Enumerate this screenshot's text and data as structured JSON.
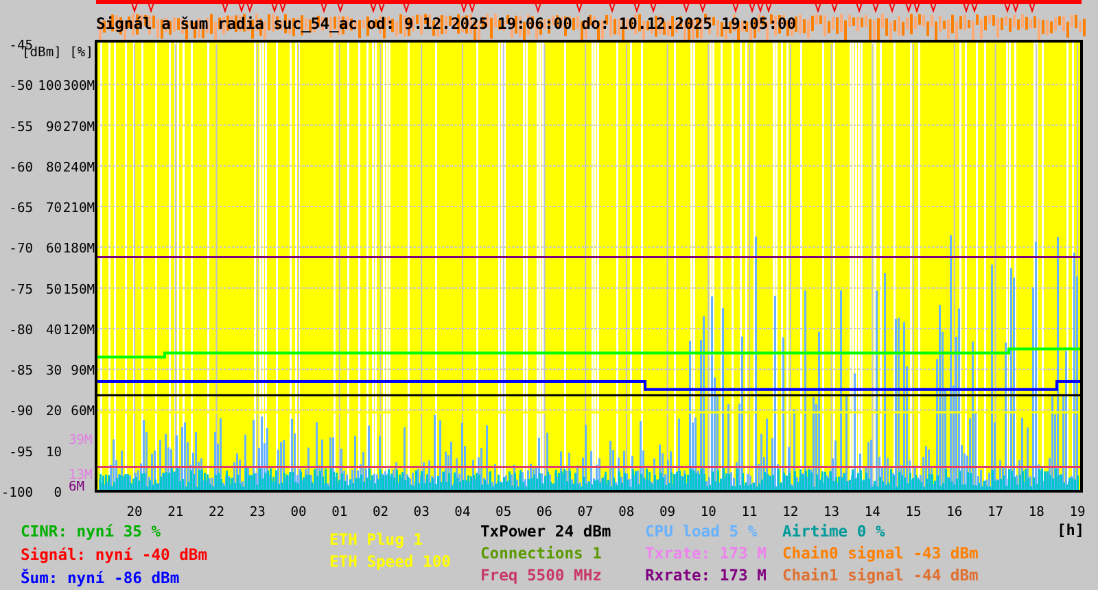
{
  "chart": {
    "title": "Signál a šum radia suc_54_ac od: 9.12.2025 19:06:00 do: 10.12.2025 19:05:00",
    "ylabel": "[dBm] [%]",
    "xlabel": "[h]",
    "hours": [
      "20",
      "21",
      "22",
      "23",
      "00",
      "01",
      "02",
      "03",
      "04",
      "05",
      "06",
      "07",
      "08",
      "09",
      "10",
      "11",
      "12",
      "13",
      "14",
      "15",
      "16",
      "17",
      "18",
      "19"
    ],
    "dbm_ticks": [
      "-45",
      "-50",
      "-55",
      "-60",
      "-65",
      "-70",
      "-75",
      "-80",
      "-85",
      "-90",
      "-95",
      "-100"
    ],
    "percent_ticks": [
      "100",
      "90",
      "80",
      "70",
      "60",
      "50",
      "40",
      "30",
      "20",
      "10",
      "0"
    ],
    "rate_ticks": [
      "300M",
      "270M",
      "240M",
      "210M",
      "180M",
      "150M",
      "120M",
      "90M",
      "60M"
    ],
    "current_values": [
      {
        "text": "39M",
        "color": "#e080e0"
      },
      {
        "text": "13M",
        "color": "#e080e0"
      },
      {
        "text": "6M",
        "color": "#800080"
      }
    ]
  },
  "legend": [
    [
      {
        "text": "CINR: nyní 35 %",
        "color": "#00b000"
      },
      {
        "text": "Signál: nyní -40 dBm",
        "color": "#ff0000"
      },
      {
        "text": "Šum: nyní -86 dBm",
        "color": "#0000ff"
      }
    ],
    [
      {
        "text": "ETH Plug 1",
        "color": "#ffff00"
      },
      {
        "text": "ETH Speed 100",
        "color": "#ffff00"
      }
    ],
    [
      {
        "text": "TxPower 24 dBm",
        "color": "#000000"
      },
      {
        "text": "Connections 1",
        "color": "#5a9a00"
      },
      {
        "text": "Freq 5500 MHz",
        "color": "#c8386a"
      }
    ],
    [
      {
        "text": "CPU load 5 %",
        "color": "#66b2ff"
      },
      {
        "text": "Txrate: 173 M",
        "color": "#ee82ee"
      },
      {
        "text": "Rxrate: 173 M",
        "color": "#800080"
      }
    ],
    [
      {
        "text": "Airtime 0 %",
        "color": "#009a9a"
      },
      {
        "text": "Chain0 signal -43 dBm",
        "color": "#ff7f00"
      },
      {
        "text": "Chain1 signal -44 dBm",
        "color": "#e07030"
      }
    ]
  ]
}
